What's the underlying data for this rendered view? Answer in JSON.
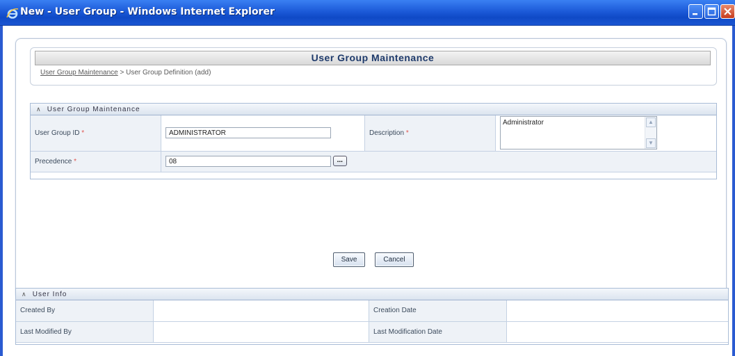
{
  "window": {
    "title": "New - User Group - Windows Internet Explorer"
  },
  "header": {
    "title": "User Group Maintenance",
    "breadcrumb_link": "User Group Maintenance",
    "breadcrumb_separator": " > ",
    "breadcrumb_current": "User Group Definition (add)"
  },
  "maintenance": {
    "section_title": "User Group Maintenance",
    "user_group_id_label": "User Group ID",
    "user_group_id_value": "ADMINISTRATOR",
    "description_label": "Description",
    "description_value": "Administrator",
    "precedence_label": "Precedence",
    "precedence_value": "08",
    "lookup_button": "...",
    "required_marker": "*"
  },
  "actions": {
    "save_label": "Save",
    "cancel_label": "Cancel"
  },
  "user_info": {
    "section_title": "User Info",
    "created_by_label": "Created By",
    "created_by_value": "",
    "creation_date_label": "Creation Date",
    "creation_date_value": "",
    "last_modified_by_label": "Last Modified By",
    "last_modified_by_value": "",
    "last_modification_date_label": "Last Modification Date",
    "last_modification_date_value": ""
  },
  "icons": {
    "browser": "ie-icon",
    "collapse": "collapse-icon",
    "minimize": "minimize-icon",
    "maximize": "maximize-icon",
    "close": "close-icon"
  },
  "colors": {
    "titlebar": "#1c5ad8",
    "required": "#e0554f",
    "header_text": "#1e3a6b"
  }
}
